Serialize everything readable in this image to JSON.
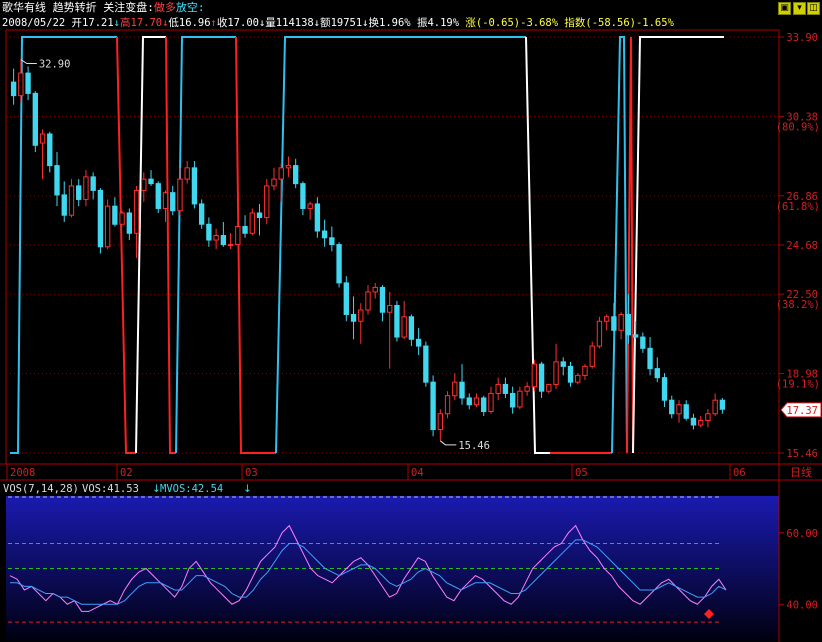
{
  "header": {
    "stock_name": "歌华有线",
    "indicator_name": "趋势转折",
    "watch_label": "关注变盘:",
    "signal_long": "做多",
    "signal_short": "放空:",
    "date": "2008/05/22",
    "open_label": "开",
    "open_value": "17.21",
    "high_label": "高",
    "high_value": "17.70",
    "low_label": "低",
    "low_value": "16.96",
    "close_label": "收",
    "close_value": "17.00",
    "vol_label": "量",
    "vol_value": "114138",
    "amount_label": "额",
    "amount_value": "19751",
    "turnover_label": "换",
    "turnover_value": "1.96%",
    "amplitude_label": "振",
    "amplitude_value": "4.19%",
    "change_text": "涨(-0.65)-3.68%",
    "index_text": "指数(-58.56)-1.65%"
  },
  "colors": {
    "up": "#ff3030",
    "down": "#40d8f0",
    "grid": "#8b0000",
    "axis": "#b00000",
    "osc_line": "#ff80ff",
    "osc_signal": "#40a0ff",
    "indicator_up": "#ffffff",
    "indicator_red": "#ff2020",
    "indicator_cyan": "#30c0f0"
  },
  "chart_data": [
    {
      "type": "candlestick",
      "title": "歌华有线",
      "y_ticks": [
        "33.90",
        "30.38",
        "26.86",
        "24.68",
        "22.50",
        "18.98",
        "15.46"
      ],
      "y_pct_ticks": [
        "(80.9%)",
        "(61.8%)",
        "(38.2%)",
        "(19.1%)"
      ],
      "ylim": [
        15.46,
        33.9
      ],
      "x_tick_labels": [
        "2008",
        "02",
        "03",
        "04",
        "05",
        "06"
      ],
      "period_label": "日线",
      "last_price": "17.37",
      "high_marker": "32.90",
      "low_marker": "15.46",
      "candles": [
        [
          31.9,
          32.5,
          30.9,
          31.3
        ],
        [
          31.3,
          32.9,
          31.0,
          32.3
        ],
        [
          32.3,
          32.6,
          31.1,
          31.4
        ],
        [
          31.4,
          31.5,
          28.8,
          29.1
        ],
        [
          29.2,
          29.8,
          27.6,
          29.6
        ],
        [
          29.6,
          29.7,
          27.9,
          28.2
        ],
        [
          28.2,
          28.8,
          26.4,
          26.9
        ],
        [
          26.9,
          27.5,
          25.7,
          26.0
        ],
        [
          26.0,
          27.6,
          25.9,
          27.3
        ],
        [
          27.3,
          27.6,
          26.4,
          26.7
        ],
        [
          26.7,
          28.0,
          26.4,
          27.7
        ],
        [
          27.7,
          27.9,
          26.7,
          27.1
        ],
        [
          27.1,
          27.2,
          24.3,
          24.6
        ],
        [
          24.6,
          26.7,
          24.5,
          26.4
        ],
        [
          26.4,
          26.8,
          25.5,
          25.6
        ],
        [
          25.6,
          26.2,
          25.6,
          26.1
        ],
        [
          26.1,
          26.3,
          24.9,
          25.2
        ],
        [
          25.2,
          27.3,
          24.1,
          27.1
        ],
        [
          27.1,
          27.9,
          26.6,
          27.6
        ],
        [
          27.6,
          28.0,
          27.3,
          27.4
        ],
        [
          27.4,
          27.5,
          26.1,
          26.3
        ],
        [
          26.3,
          27.1,
          25.7,
          27.0
        ],
        [
          27.0,
          27.3,
          26.0,
          26.2
        ],
        [
          26.2,
          28.1,
          26.0,
          27.6
        ],
        [
          27.6,
          28.4,
          27.4,
          28.1
        ],
        [
          28.1,
          28.4,
          26.3,
          26.5
        ],
        [
          26.5,
          26.7,
          25.4,
          25.6
        ],
        [
          25.6,
          25.9,
          24.6,
          24.9
        ],
        [
          24.9,
          25.4,
          24.5,
          25.1
        ],
        [
          25.1,
          25.7,
          24.6,
          24.7
        ],
        [
          24.7,
          25.2,
          24.5,
          24.7
        ],
        [
          24.7,
          25.7,
          24.7,
          25.5
        ],
        [
          25.5,
          26.0,
          25.0,
          25.2
        ],
        [
          25.2,
          26.3,
          25.1,
          26.1
        ],
        [
          26.1,
          26.5,
          25.1,
          25.9
        ],
        [
          25.9,
          27.6,
          25.6,
          27.3
        ],
        [
          27.3,
          28.1,
          27.1,
          27.6
        ],
        [
          27.6,
          28.3,
          26.6,
          28.1
        ],
        [
          28.1,
          28.6,
          27.7,
          28.2
        ],
        [
          28.2,
          28.5,
          27.2,
          27.4
        ],
        [
          27.4,
          27.5,
          26.0,
          26.3
        ],
        [
          26.3,
          26.6,
          25.8,
          26.5
        ],
        [
          26.5,
          26.8,
          25.0,
          25.3
        ],
        [
          25.3,
          25.8,
          24.6,
          25.0
        ],
        [
          25.0,
          25.5,
          24.4,
          24.7
        ],
        [
          24.7,
          24.8,
          22.8,
          23.0
        ],
        [
          23.0,
          23.3,
          21.3,
          21.6
        ],
        [
          21.6,
          22.4,
          20.5,
          21.3
        ],
        [
          21.3,
          22.1,
          20.3,
          21.8
        ],
        [
          21.8,
          22.9,
          21.6,
          22.6
        ],
        [
          22.6,
          23.0,
          22.3,
          22.8
        ],
        [
          22.8,
          22.9,
          21.3,
          21.7
        ],
        [
          21.7,
          22.6,
          19.2,
          22.0
        ],
        [
          22.0,
          22.2,
          20.4,
          20.6
        ],
        [
          20.6,
          22.2,
          20.5,
          21.5
        ],
        [
          21.5,
          21.6,
          20.2,
          20.5
        ],
        [
          20.5,
          21.0,
          19.8,
          20.2
        ],
        [
          20.2,
          20.4,
          18.4,
          18.6
        ],
        [
          18.6,
          18.9,
          16.2,
          16.5
        ],
        [
          16.5,
          17.4,
          16.0,
          17.2
        ],
        [
          17.2,
          18.2,
          17.0,
          18.0
        ],
        [
          18.0,
          19.0,
          17.8,
          18.6
        ],
        [
          18.6,
          19.4,
          17.6,
          17.9
        ],
        [
          17.9,
          18.1,
          17.4,
          17.6
        ],
        [
          17.6,
          18.1,
          17.5,
          17.9
        ],
        [
          17.9,
          18.0,
          17.1,
          17.3
        ],
        [
          17.3,
          18.4,
          17.2,
          18.1
        ],
        [
          18.1,
          18.8,
          17.8,
          18.5
        ],
        [
          18.5,
          18.8,
          17.9,
          18.1
        ],
        [
          18.1,
          18.4,
          17.2,
          17.5
        ],
        [
          17.5,
          18.4,
          17.4,
          18.2
        ],
        [
          18.2,
          18.6,
          18.0,
          18.4
        ],
        [
          18.4,
          19.6,
          18.2,
          19.4
        ],
        [
          19.4,
          19.5,
          17.9,
          18.2
        ],
        [
          18.2,
          18.5,
          18.1,
          18.5
        ],
        [
          18.5,
          20.3,
          18.3,
          19.5
        ],
        [
          19.5,
          19.7,
          18.9,
          19.3
        ],
        [
          19.3,
          19.5,
          18.4,
          18.6
        ],
        [
          18.6,
          19.0,
          18.5,
          18.9
        ],
        [
          18.9,
          19.4,
          18.7,
          19.3
        ],
        [
          19.3,
          20.4,
          19.2,
          20.2
        ],
        [
          20.2,
          21.5,
          20.1,
          21.3
        ],
        [
          21.3,
          21.6,
          20.9,
          21.5
        ],
        [
          21.5,
          22.1,
          20.8,
          20.9
        ],
        [
          20.9,
          21.7,
          20.5,
          21.6
        ],
        [
          21.6,
          22.5,
          20.3,
          20.7
        ],
        [
          20.7,
          21.3,
          20.5,
          20.6
        ],
        [
          20.6,
          20.8,
          19.9,
          20.1
        ],
        [
          20.1,
          20.6,
          18.9,
          19.2
        ],
        [
          19.2,
          19.7,
          18.6,
          18.8
        ],
        [
          18.8,
          19.0,
          17.5,
          17.8
        ],
        [
          17.8,
          18.0,
          17.0,
          17.2
        ],
        [
          17.2,
          17.8,
          16.8,
          17.6
        ],
        [
          17.6,
          17.8,
          16.9,
          17.0
        ],
        [
          17.0,
          17.2,
          16.5,
          16.7
        ],
        [
          16.7,
          17.1,
          16.6,
          16.9
        ],
        [
          16.9,
          17.4,
          16.6,
          17.2
        ],
        [
          17.2,
          18.1,
          17.1,
          17.8
        ],
        [
          17.8,
          17.9,
          17.2,
          17.4
        ]
      ]
    },
    {
      "type": "line",
      "title": "VOS(7,14,28)",
      "series": [
        {
          "name": "VOS",
          "value_text": "41.53",
          "values": [
            48,
            47,
            44,
            45,
            43,
            41,
            43,
            42,
            40,
            41,
            38,
            38,
            39,
            40,
            41,
            40,
            44,
            47,
            49,
            50,
            48,
            46,
            44,
            42,
            45,
            50,
            52,
            49,
            46,
            44,
            42,
            40,
            41,
            44,
            48,
            52,
            54,
            56,
            60,
            62,
            58,
            54,
            50,
            48,
            47,
            46,
            48,
            50,
            52,
            53,
            51,
            48,
            45,
            42,
            43,
            47,
            50,
            53,
            52,
            48,
            45,
            42,
            41,
            44,
            46,
            48,
            47,
            45,
            43,
            41,
            40,
            42,
            46,
            50,
            52,
            54,
            56,
            57,
            60,
            62,
            58,
            55,
            53,
            50,
            48,
            45,
            43,
            41,
            40,
            42,
            44,
            46,
            47,
            45,
            43,
            41,
            40,
            42,
            45,
            47,
            44
          ]
        },
        {
          "name": "MVOS",
          "value_text": "42.54",
          "values": [
            46,
            46,
            45,
            45,
            44,
            43,
            43,
            42,
            42,
            41,
            40,
            40,
            40,
            40,
            40,
            40,
            41,
            43,
            45,
            46,
            46,
            46,
            45,
            44,
            44,
            46,
            48,
            48,
            47,
            46,
            45,
            43,
            42,
            42,
            44,
            47,
            49,
            52,
            55,
            57,
            57,
            56,
            54,
            52,
            50,
            49,
            48,
            49,
            50,
            51,
            51,
            50,
            48,
            46,
            45,
            46,
            47,
            49,
            50,
            49,
            48,
            46,
            45,
            44,
            45,
            46,
            46,
            46,
            45,
            44,
            43,
            43,
            44,
            46,
            48,
            50,
            52,
            54,
            56,
            58,
            58,
            57,
            56,
            54,
            52,
            50,
            48,
            46,
            44,
            44,
            44,
            45,
            46,
            45,
            44,
            43,
            42,
            42,
            43,
            45,
            44
          ]
        }
      ],
      "y_ticks": [
        "60.00",
        "40.00"
      ],
      "ylim": [
        30,
        70
      ]
    }
  ]
}
